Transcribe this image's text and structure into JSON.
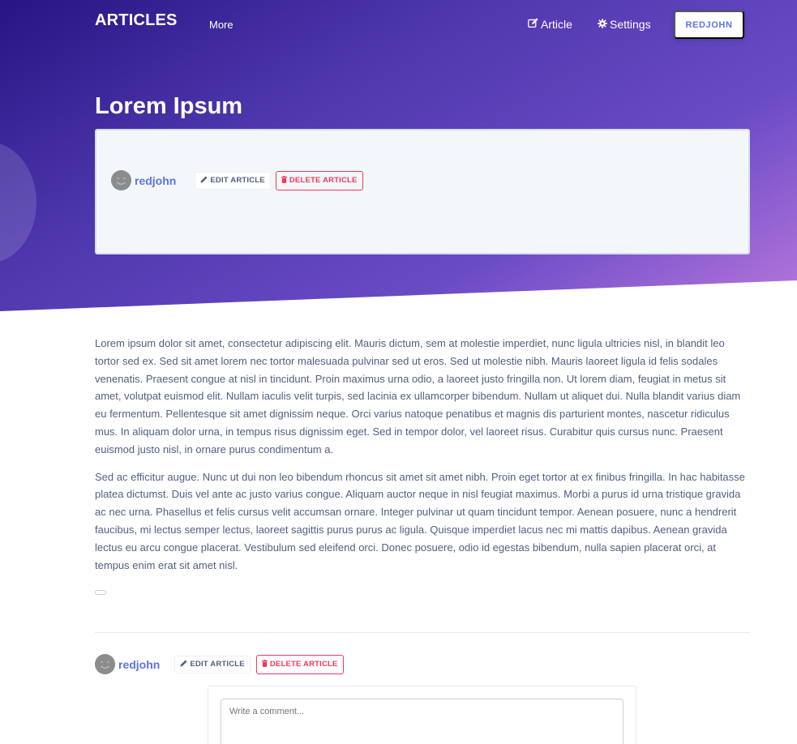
{
  "navbar": {
    "brand": "ARTICLES",
    "more_label": "More",
    "article_label": "Article",
    "settings_label": "Settings",
    "user_button": "REDJOHN"
  },
  "article": {
    "title": "Lorem Ipsum",
    "author": "redjohn",
    "edit_label": "EDIT ARTICLE",
    "delete_label": "DELETE ARTICLE",
    "paragraphs": [
      "Lorem ipsum dolor sit amet, consectetur adipiscing elit. Mauris dictum, sem at molestie imperdiet, nunc ligula ultricies nisl, in blandit leo tortor sed ex. Sed sit amet lorem nec tortor malesuada pulvinar sed ut eros. Sed ut molestie nibh. Mauris laoreet ligula id felis sodales venenatis. Praesent congue at nisl in tincidunt. Proin maximus urna odio, a laoreet justo fringilla non. Ut lorem diam, feugiat in metus sit amet, volutpat euismod elit. Nullam iaculis velit turpis, sed lacinia ex ullamcorper bibendum. Nullam ut aliquet dui. Nulla blandit varius diam eu fermentum. Pellentesque sit amet dignissim neque. Orci varius natoque penatibus et magnis dis parturient montes, nascetur ridiculus mus. In aliquam dolor urna, in tempus risus dignissim eget. Sed in tempor dolor, vel laoreet risus. Curabitur quis cursus nunc. Praesent euismod justo nisl, in ornare purus condimentum a.",
      "Sed ac efficitur augue. Nunc ut dui non leo bibendum rhoncus sit amet sit amet nibh. Proin eget tortor at ex finibus fringilla. In hac habitasse platea dictumst. Duis vel ante ac justo varius congue. Aliquam auctor neque in nisl feugiat maximus. Morbi a purus id urna tristique gravida ac nec urna. Phasellus et felis cursus velit accumsan ornare. Integer pulvinar ut quam tincidunt tempor. Aenean posuere, nunc a hendrerit faucibus, mi lectus semper lectus, laoreet sagittis purus purus ac ligula. Quisque imperdiet lacus nec mi mattis dapibus. Aenean gravida lectus eu arcu congue placerat. Vestibulum sed eleifend orci. Donec posuere, odio id egestas bibendum, nulla sapien placerat orci, at tempus enim erat sit amet nisl."
    ]
  },
  "comment": {
    "placeholder": "Write a comment..."
  },
  "colors": {
    "primary": "#5e72e4",
    "danger": "#f5365c",
    "hero_start": "#281483",
    "hero_end": "#b877dc"
  },
  "icons": {
    "article": "edit-icon",
    "settings": "gear-icon",
    "edit": "pencil-icon",
    "delete": "trash-icon",
    "avatar": "smiley-avatar"
  }
}
